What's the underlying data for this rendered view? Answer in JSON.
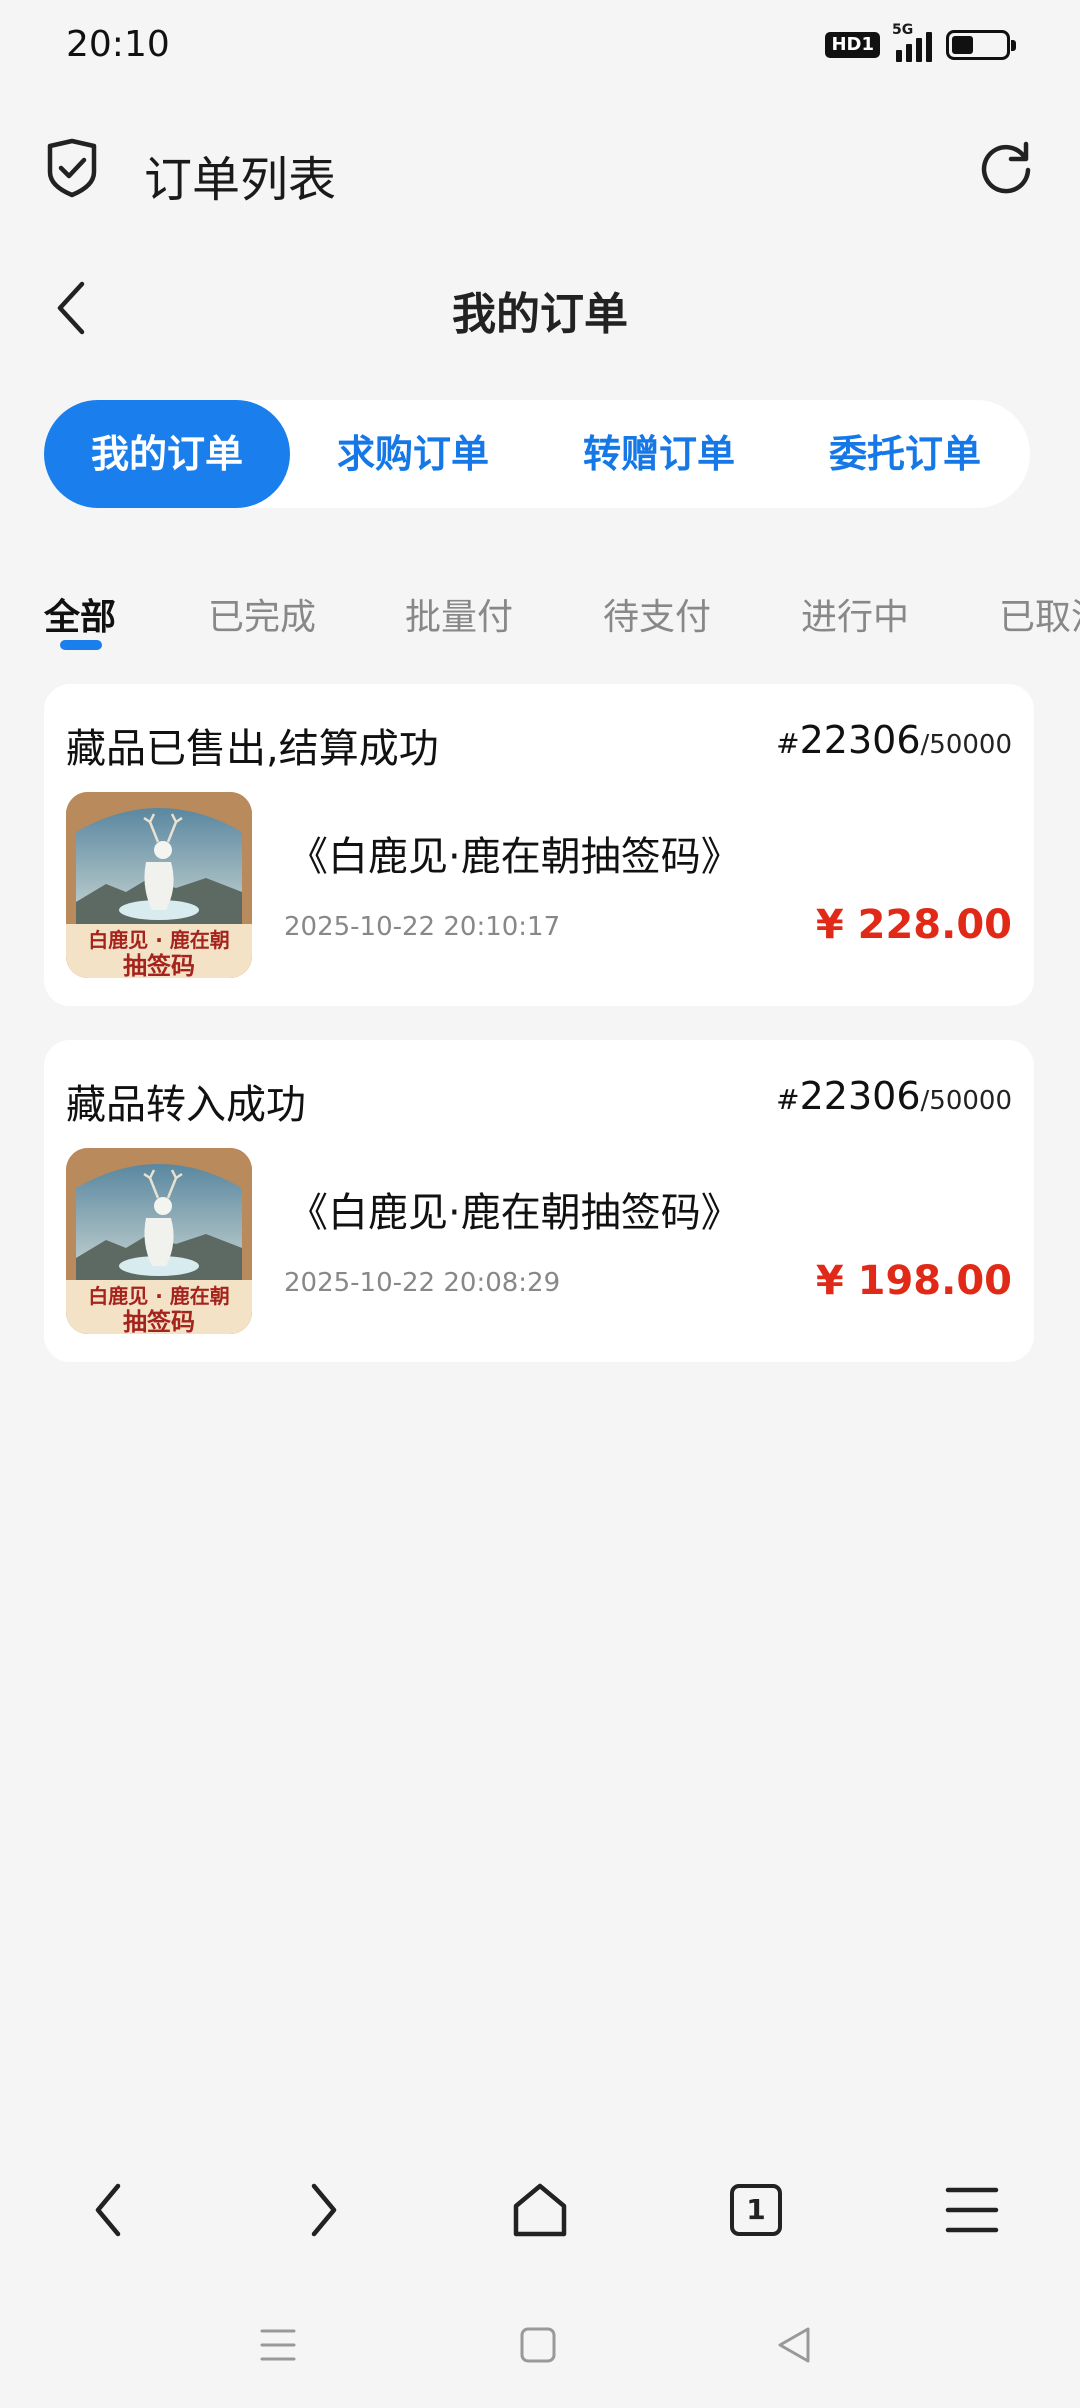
{
  "status_bar": {
    "time": "20:10",
    "hd_badge": "HD1",
    "network": "5G",
    "battery_level": 0.4
  },
  "browser": {
    "title": "订单列表",
    "shield_icon": "shield-check-icon",
    "reload_icon": "reload-icon"
  },
  "header": {
    "title": "我的订单",
    "back_icon": "chevron-left-icon"
  },
  "segment_tabs": [
    {
      "label": "我的订单",
      "active": true
    },
    {
      "label": "求购订单",
      "active": false
    },
    {
      "label": "转赠订单",
      "active": false
    },
    {
      "label": "委托订单",
      "active": false
    }
  ],
  "filter_tabs": [
    {
      "label": "全部",
      "active": true
    },
    {
      "label": "已完成",
      "active": false
    },
    {
      "label": "批量付",
      "active": false
    },
    {
      "label": "待支付",
      "active": false
    },
    {
      "label": "进行中",
      "active": false
    },
    {
      "label": "已取消",
      "active": false
    }
  ],
  "orders": [
    {
      "status": "藏品已售出,结算成功",
      "serial_hash": "#",
      "serial_no": "22306",
      "serial_total": "/50000",
      "thumb_text_1": "白鹿见 · 鹿在朝",
      "thumb_text_2": "抽签码",
      "name": "《白鹿见·鹿在朝抽签码》",
      "time": "2025-10-22 20:10:17",
      "price": "¥ 228.00"
    },
    {
      "status": "藏品转入成功",
      "serial_hash": "#",
      "serial_no": "22306",
      "serial_total": "/50000",
      "thumb_text_1": "白鹿见 · 鹿在朝",
      "thumb_text_2": "抽签码",
      "name": "《白鹿见·鹿在朝抽签码》",
      "time": "2025-10-22 20:08:29",
      "price": "¥ 198.00"
    }
  ],
  "toolbar": {
    "back_icon": "chevron-left-icon",
    "forward_icon": "chevron-right-icon",
    "home_icon": "home-icon",
    "tab_count": "1",
    "menu_icon": "menu-icon"
  },
  "system_nav": {
    "recents_icon": "recents-icon",
    "home_icon": "home-square-icon",
    "back_icon": "back-triangle-icon"
  },
  "colors": {
    "accent": "#1a7eec",
    "price": "#e02a17",
    "background": "#f5f5f5"
  }
}
